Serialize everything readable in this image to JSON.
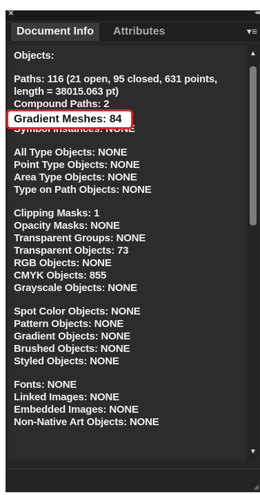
{
  "titlebar": {
    "close_glyph": "×",
    "collapse_glyph": "◂◂"
  },
  "tabs": [
    {
      "label": "Document Info"
    },
    {
      "label": "Attributes"
    }
  ],
  "panel_menu_glyph": "▾≡",
  "groups": [
    {
      "lines": [
        "Objects:"
      ]
    },
    {
      "lines": [
        "Paths: 116 (21 open, 95 closed, 631 points,",
        "length = 38015.063 pt)",
        "Compound Paths: 2",
        "Gradient Meshes: 84",
        "Symbol Instances: NONE"
      ]
    },
    {
      "lines": [
        "All Type Objects: NONE",
        "Point Type Objects: NONE",
        "Area Type Objects: NONE",
        "Type on Path Objects: NONE"
      ]
    },
    {
      "lines": [
        "Clipping Masks: 1",
        "Opacity Masks: NONE",
        "Transparent Groups: NONE",
        "Transparent Objects: 73",
        "RGB Objects: NONE",
        "CMYK Objects: 855",
        "Grayscale Objects: NONE"
      ]
    },
    {
      "lines": [
        "Spot Color Objects: NONE",
        "Pattern Objects: NONE",
        "Gradient Objects: NONE",
        "Brushed Objects: NONE",
        "Styled Objects: NONE"
      ]
    },
    {
      "lines": [
        "Fonts: NONE",
        "Linked Images: NONE",
        "Embedded Images: NONE",
        "Non-Native Art Objects: NONE"
      ]
    }
  ],
  "highlight_text": "Gradient Meshes: 84",
  "scrollbar": {
    "up_glyph": "▲",
    "down_glyph": "▼"
  },
  "colors": {
    "panel_bg": "#2c2c2c",
    "highlight_border": "#e0202a"
  }
}
